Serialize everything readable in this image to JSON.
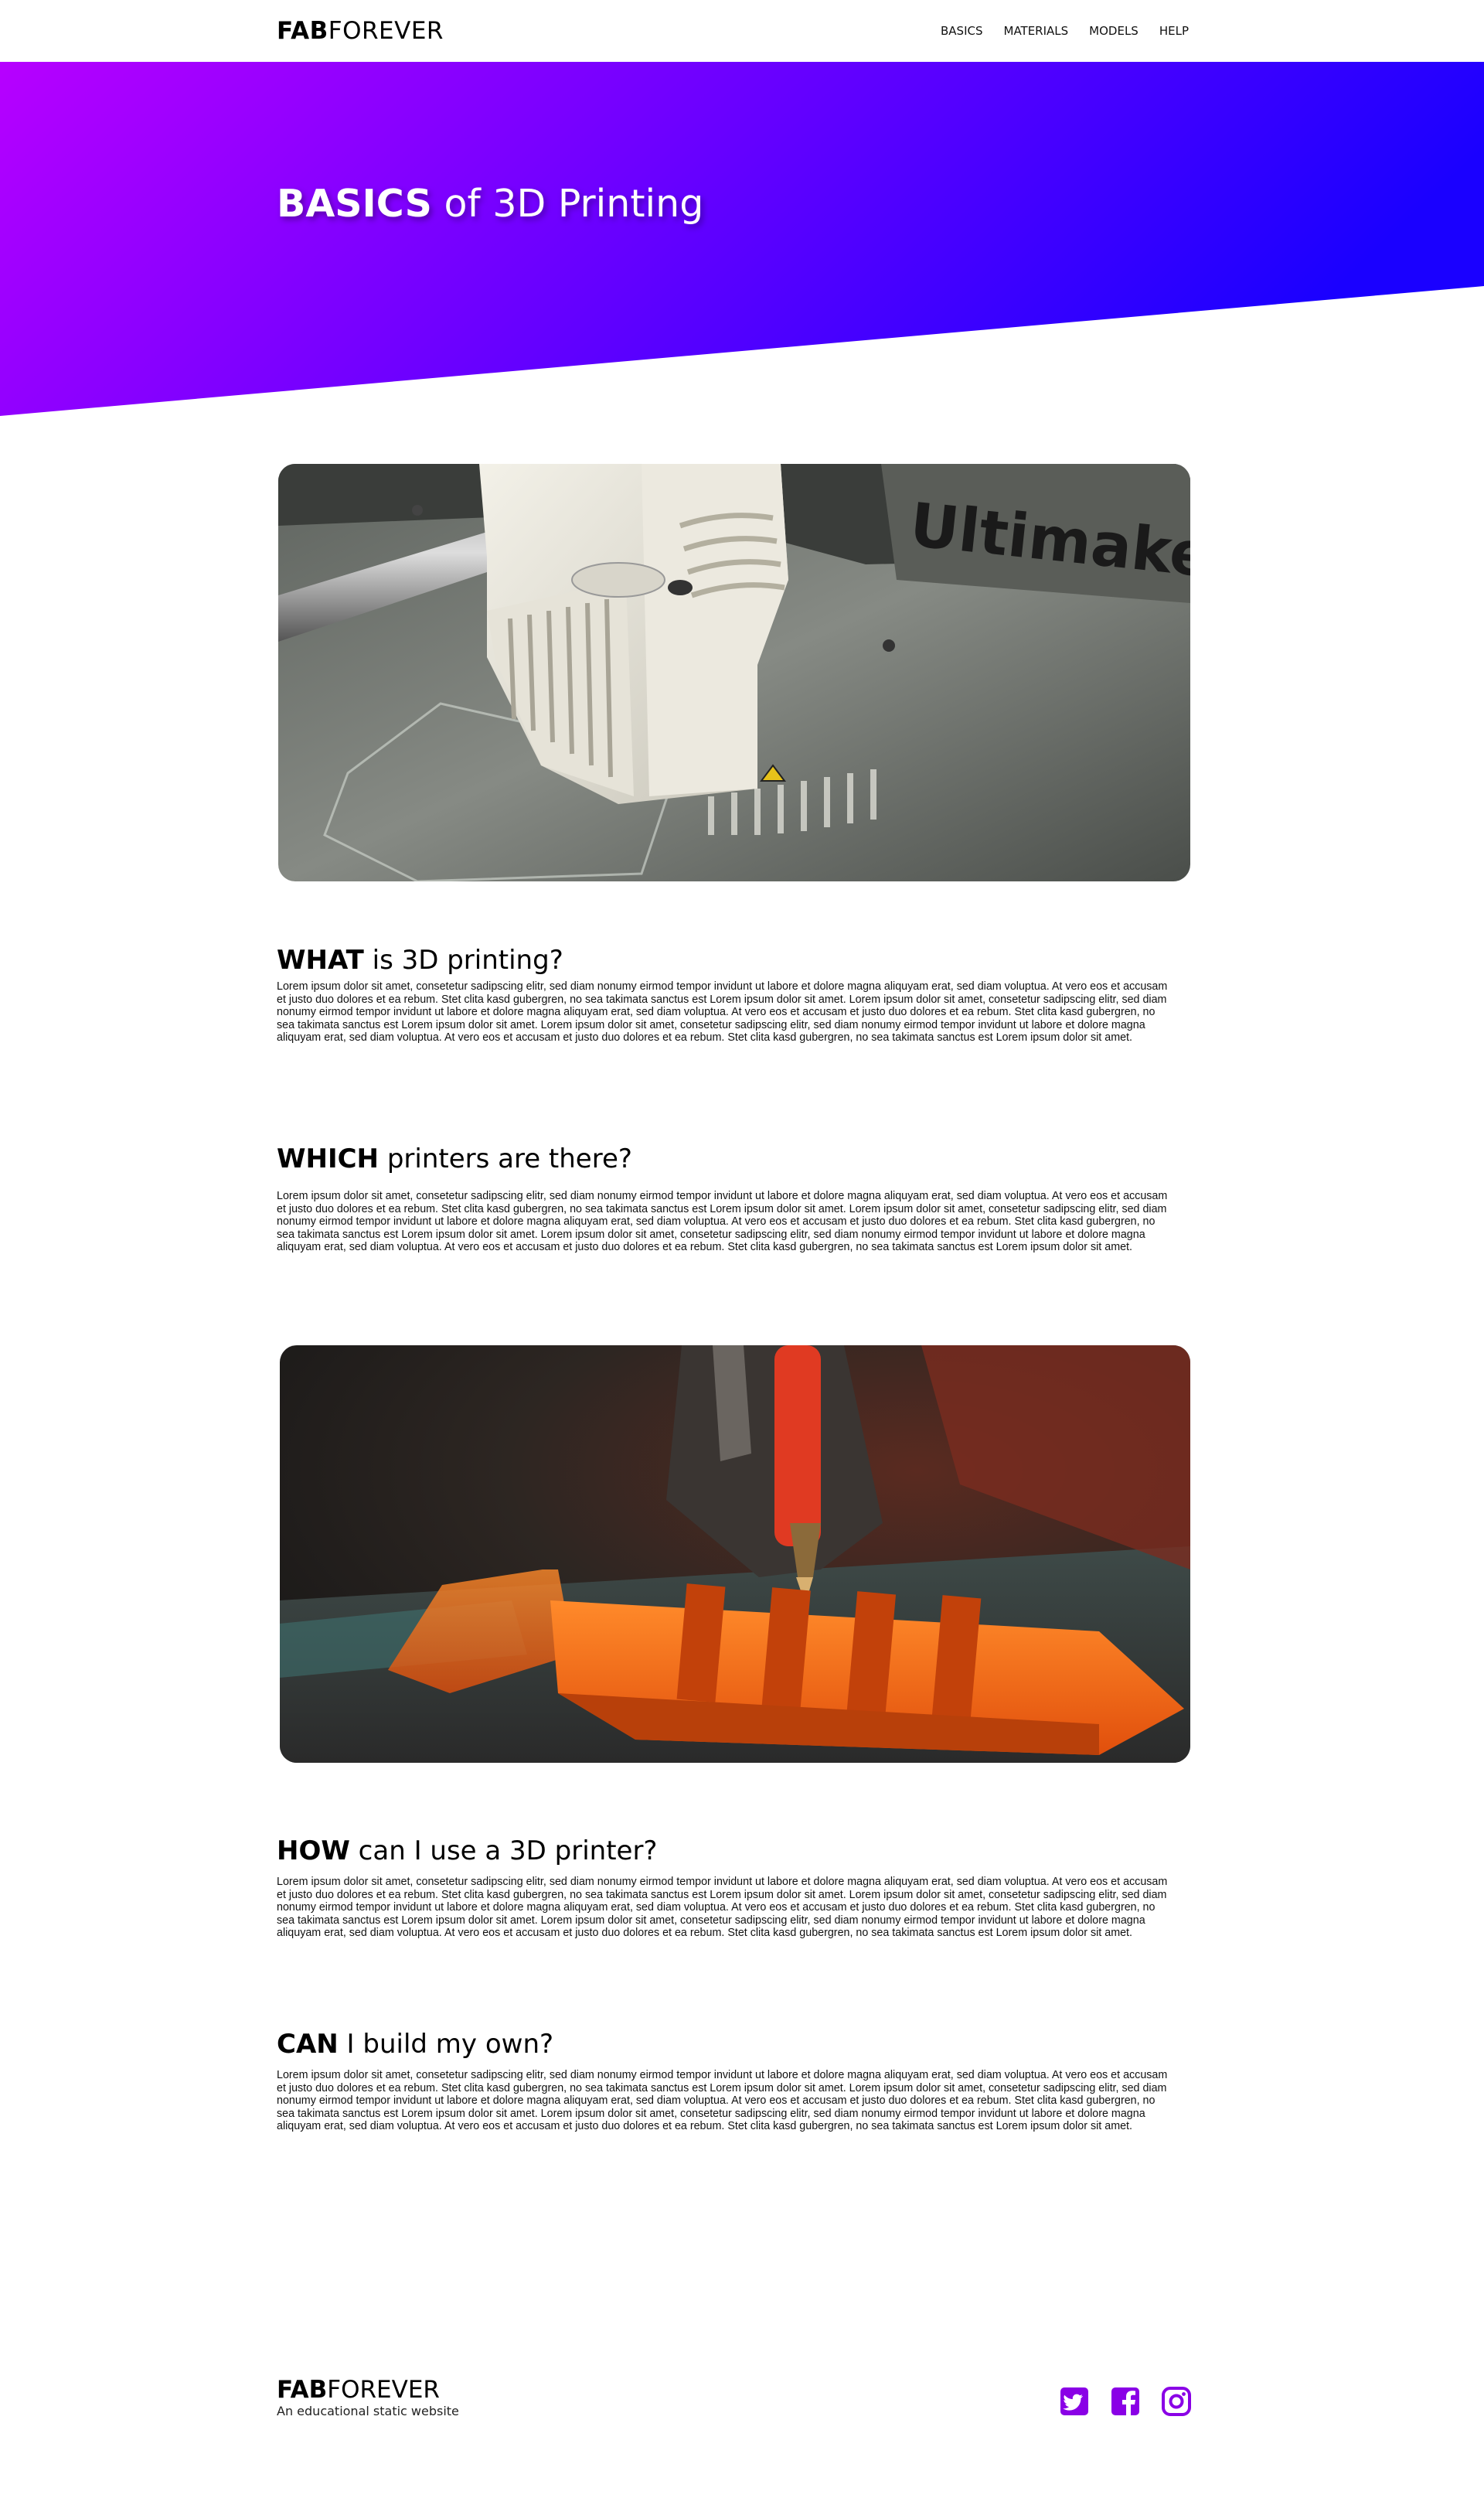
{
  "brand": {
    "bold": "FAB",
    "regular": "FOREVER"
  },
  "nav": [
    {
      "label": "BASICS"
    },
    {
      "label": "MATERIALS"
    },
    {
      "label": "MODELS"
    },
    {
      "label": "HELP"
    }
  ],
  "hero": {
    "title_bold": "BASICS",
    "title_rest": " of 3D Printing",
    "gradient_start": "#b700ff",
    "gradient_end": "#1a00ff"
  },
  "sections": [
    {
      "heading_bold": "WHAT",
      "heading_rest": " is 3D printing?",
      "body": "Lorem ipsum dolor sit amet, consetetur sadipscing elitr, sed diam nonumy eirmod tempor invidunt ut labore et dolore magna aliquyam erat, sed diam voluptua. At vero eos et accusam et justo duo dolores et ea rebum. Stet clita kasd gubergren, no sea takimata sanctus est Lorem ipsum dolor sit amet. Lorem ipsum dolor sit amet, consetetur sadipscing elitr, sed diam nonumy eirmod tempor invidunt ut labore et dolore magna aliquyam erat, sed diam voluptua. At vero eos et accusam et justo duo dolores et ea rebum. Stet clita kasd gubergren, no sea takimata sanctus est Lorem ipsum dolor sit amet. Lorem ipsum dolor sit amet, consetetur sadipscing elitr, sed diam nonumy eirmod tempor invidunt ut labore et dolore magna aliquyam erat, sed diam voluptua. At vero eos et accusam et justo duo dolores et ea rebum. Stet clita kasd gubergren, no sea takimata sanctus est Lorem ipsum dolor sit amet."
    },
    {
      "heading_bold": "WHICH",
      "heading_rest": " printers are there?",
      "body": "Lorem ipsum dolor sit amet, consetetur sadipscing elitr, sed diam nonumy eirmod tempor invidunt ut labore et dolore magna aliquyam erat, sed diam voluptua. At vero eos et accusam et justo duo dolores et ea rebum. Stet clita kasd gubergren, no sea takimata sanctus est Lorem ipsum dolor sit amet. Lorem ipsum dolor sit amet, consetetur sadipscing elitr, sed diam nonumy eirmod tempor invidunt ut labore et dolore magna aliquyam erat, sed diam voluptua. At vero eos et accusam et justo duo dolores et ea rebum. Stet clita kasd gubergren, no sea takimata sanctus est Lorem ipsum dolor sit amet. Lorem ipsum dolor sit amet, consetetur sadipscing elitr, sed diam nonumy eirmod tempor invidunt ut labore et dolore magna aliquyam erat, sed diam voluptua. At vero eos et accusam et justo duo dolores et ea rebum. Stet clita kasd gubergren, no sea takimata sanctus est Lorem ipsum dolor sit amet."
    },
    {
      "heading_bold": "HOW",
      "heading_rest": " can I use a 3D printer?",
      "body": "Lorem ipsum dolor sit amet, consetetur sadipscing elitr, sed diam nonumy eirmod tempor invidunt ut labore et dolore magna aliquyam erat, sed diam voluptua. At vero eos et accusam et justo duo dolores et ea rebum. Stet clita kasd gubergren, no sea takimata sanctus est Lorem ipsum dolor sit amet. Lorem ipsum dolor sit amet, consetetur sadipscing elitr, sed diam nonumy eirmod tempor invidunt ut labore et dolore magna aliquyam erat, sed diam voluptua. At vero eos et accusam et justo duo dolores et ea rebum. Stet clita kasd gubergren, no sea takimata sanctus est Lorem ipsum dolor sit amet. Lorem ipsum dolor sit amet, consetetur sadipscing elitr, sed diam nonumy eirmod tempor invidunt ut labore et dolore magna aliquyam erat, sed diam voluptua. At vero eos et accusam et justo duo dolores et ea rebum. Stet clita kasd gubergren, no sea takimata sanctus est Lorem ipsum dolor sit amet."
    },
    {
      "heading_bold": "CAN",
      "heading_rest": " I build my own?",
      "body": "Lorem ipsum dolor sit amet, consetetur sadipscing elitr, sed diam nonumy eirmod tempor invidunt ut labore et dolore magna aliquyam erat, sed diam voluptua. At vero eos et accusam et justo duo dolores et ea rebum. Stet clita kasd gubergren, no sea takimata sanctus est Lorem ipsum dolor sit amet. Lorem ipsum dolor sit amet, consetetur sadipscing elitr, sed diam nonumy eirmod tempor invidunt ut labore et dolore magna aliquyam erat, sed diam voluptua. At vero eos et accusam et justo duo dolores et ea rebum. Stet clita kasd gubergren, no sea takimata sanctus est Lorem ipsum dolor sit amet. Lorem ipsum dolor sit amet, consetetur sadipscing elitr, sed diam nonumy eirmod tempor invidunt ut labore et dolore magna aliquyam erat, sed diam voluptua. At vero eos et accusam et justo duo dolores et ea rebum. Stet clita kasd gubergren, no sea takimata sanctus est Lorem ipsum dolor sit amet."
    }
  ],
  "images": [
    {
      "logo_text": "Ultimaker"
    }
  ],
  "footer": {
    "tagline": "An educational static website",
    "icon_color": "#8a00e6",
    "social": [
      {
        "icon": "twitter-icon"
      },
      {
        "icon": "facebook-icon"
      },
      {
        "icon": "instagram-icon"
      }
    ]
  }
}
